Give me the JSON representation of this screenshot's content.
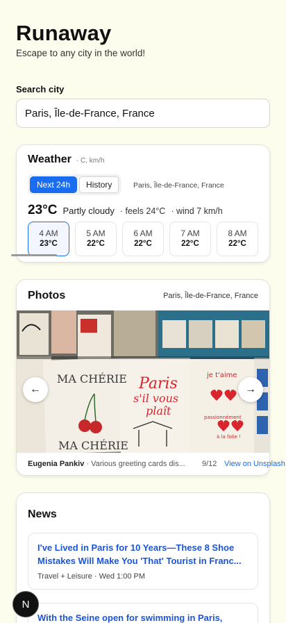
{
  "app": {
    "title": "Runaway",
    "subtitle": "Escape to any city in the world!"
  },
  "search": {
    "label": "Search city",
    "value": "Paris, Île-de-France, France"
  },
  "weather": {
    "title": "Weather",
    "units": "· C, km/h",
    "tabs": [
      "Next 24h",
      "History"
    ],
    "active_tab": "Next 24h",
    "location": "Paris, Île-de-France, France",
    "current": {
      "temp": "23°C",
      "condition": "Partly cloudy",
      "feels": "· feels 24°C",
      "wind": "· wind 7 km/h"
    },
    "hours": [
      {
        "time": "4 AM",
        "temp": "23°C"
      },
      {
        "time": "5 AM",
        "temp": "22°C"
      },
      {
        "time": "6 AM",
        "temp": "22°C"
      },
      {
        "time": "7 AM",
        "temp": "22°C"
      },
      {
        "time": "8 AM",
        "temp": "22°C"
      }
    ]
  },
  "photos": {
    "title": "Photos",
    "location": "Paris, Île-de-France, France",
    "author": "Eugenia Pankiv",
    "description": "· Various greeting cards dis...",
    "counter": "9/12",
    "link": "View on Unsplash",
    "card_text": {
      "ma_cherie": "MA CHÉRIE",
      "paris": "Paris",
      "sil_vous": "s'il vous",
      "plait": "plaît",
      "je_taime": "je t'aime",
      "passion": "passionnément",
      "folie": "à la folie !"
    }
  },
  "news": {
    "title": "News",
    "articles": [
      {
        "title": "I've Lived in Paris for 10 Years—These 8 Shoe Mistakes Will Make You 'That' Tourist in Franc...",
        "source": "Travel + Leisure",
        "time": "· Wed 1:00 PM"
      },
      {
        "title": "With the Seine open for swimming in Paris,",
        "source": "",
        "time": ""
      }
    ]
  },
  "fab": {
    "label": "N"
  },
  "colors": {
    "accent": "#1a6cf0",
    "background": "#fdfdee"
  }
}
